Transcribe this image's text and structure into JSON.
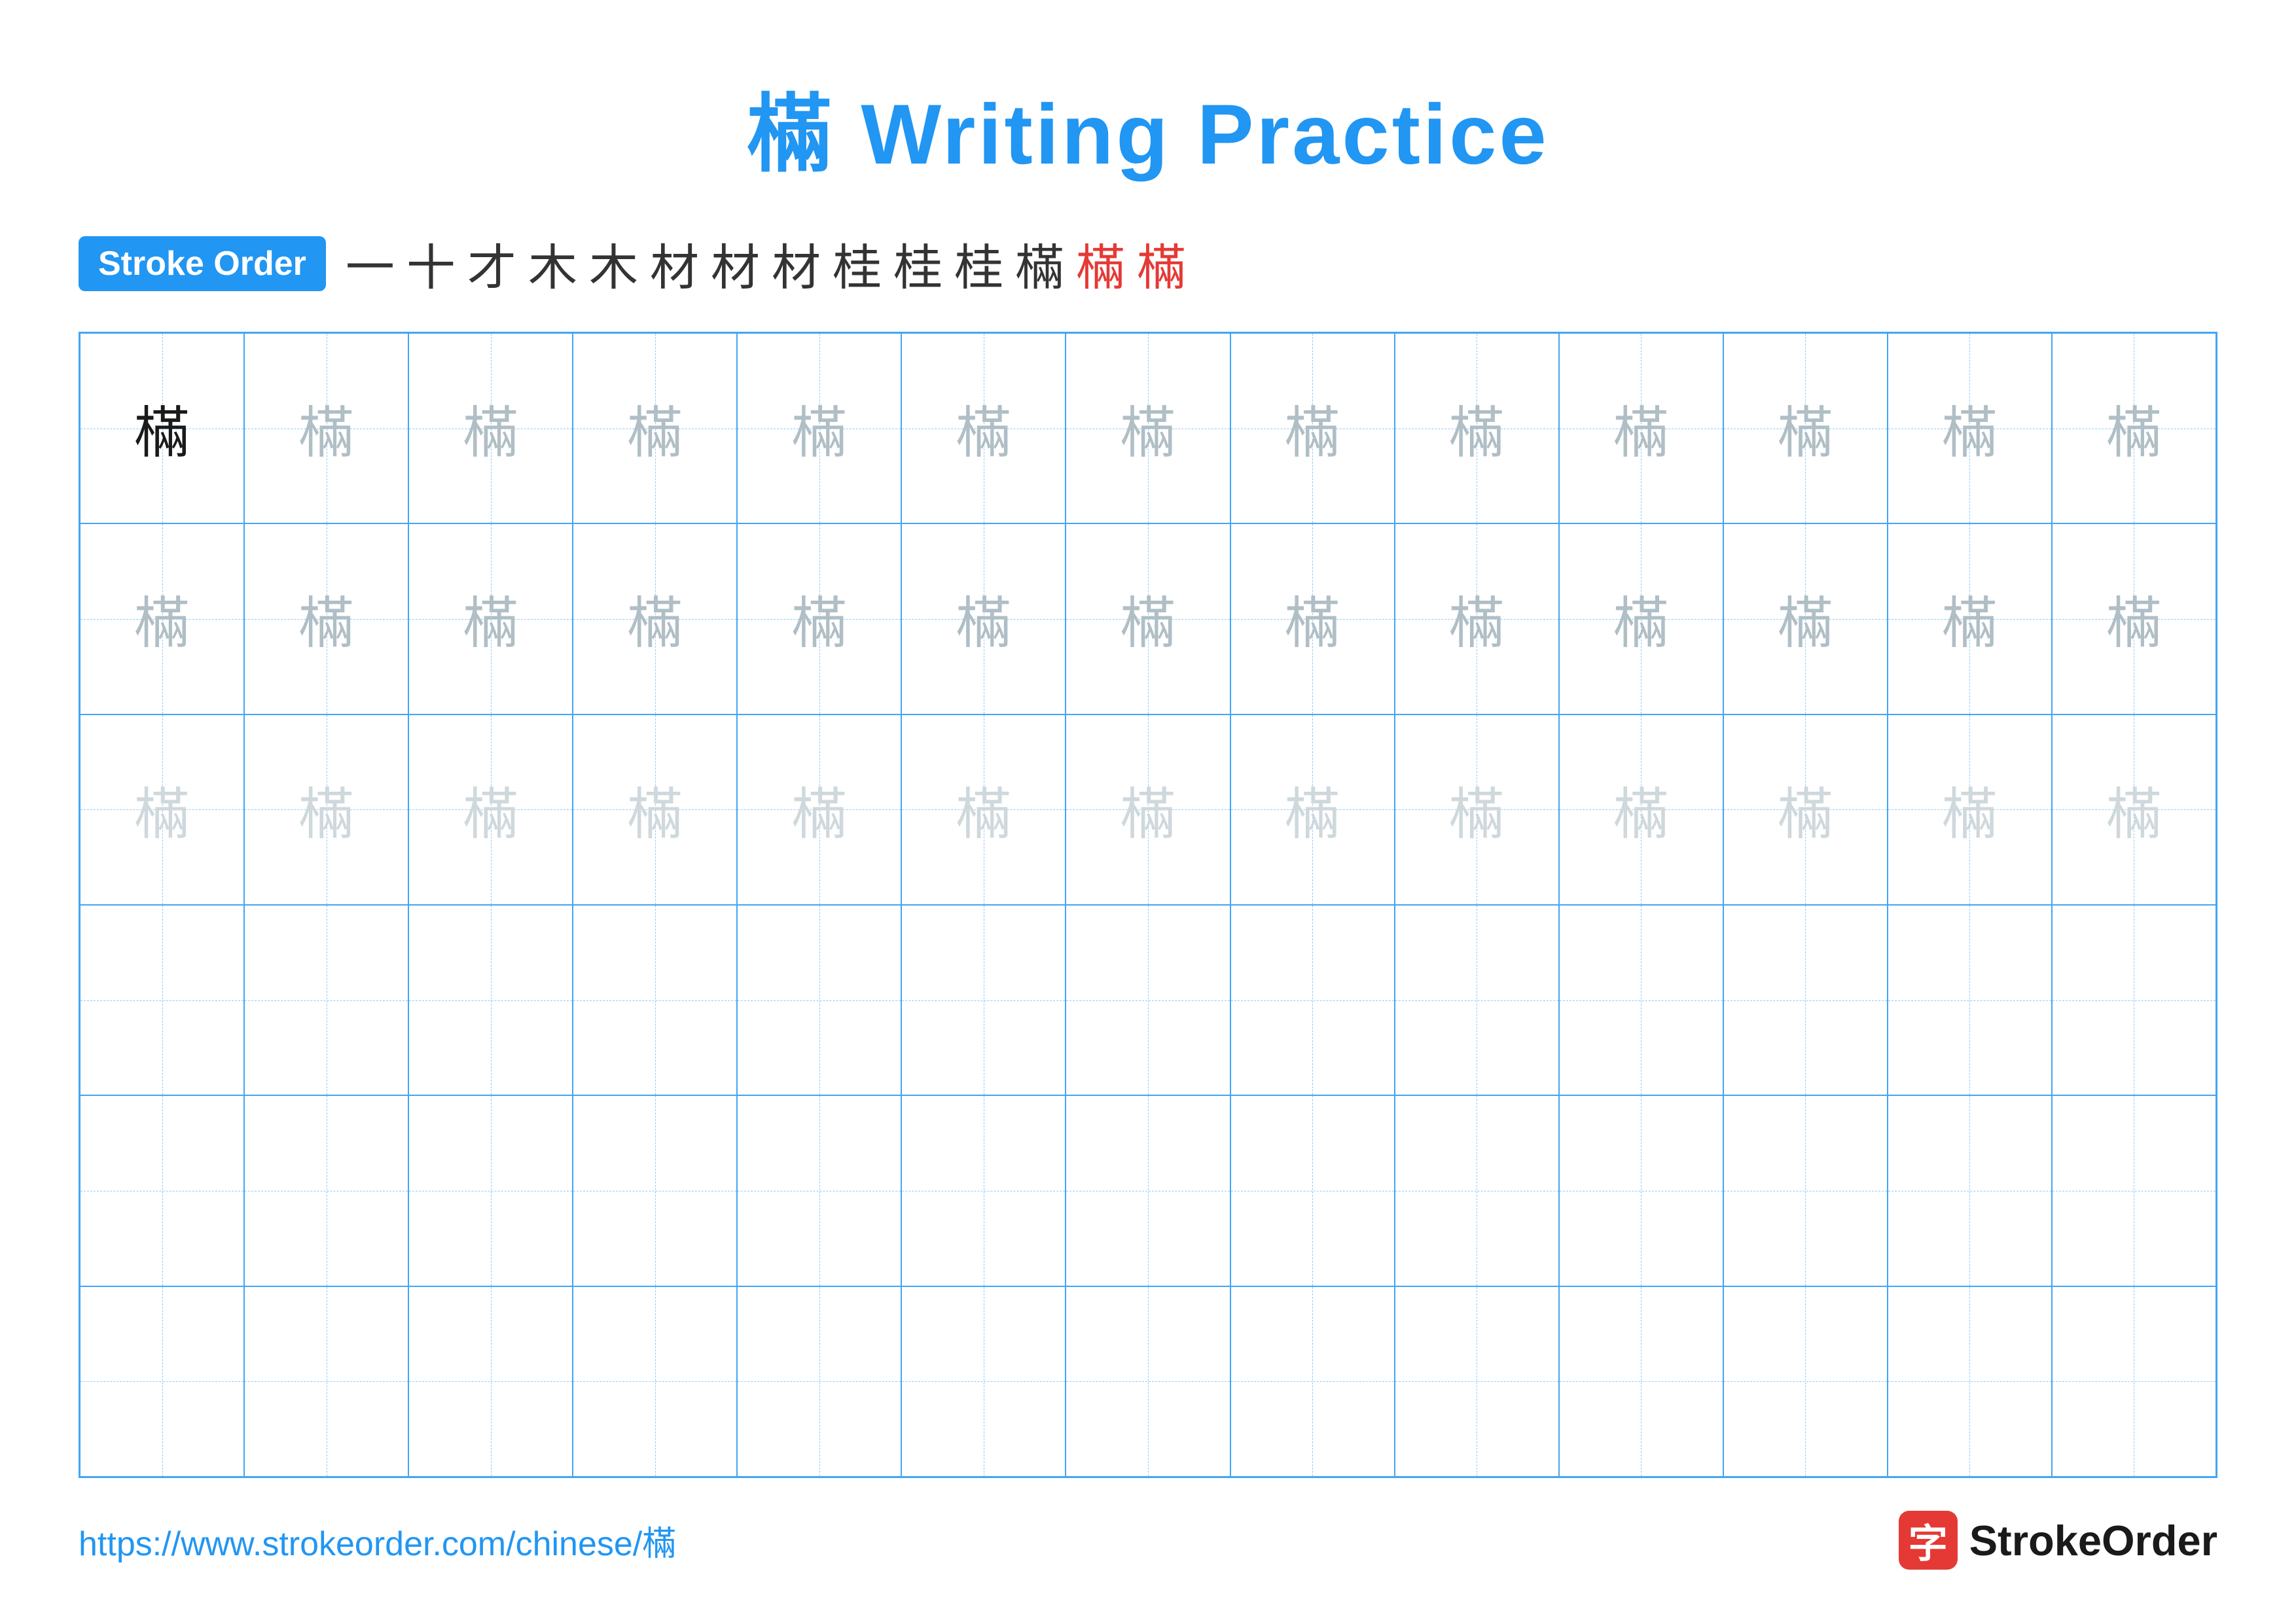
{
  "title": {
    "char": "樠",
    "text": " Writing Practice"
  },
  "stroke_order": {
    "badge_label": "Stroke Order",
    "steps": [
      "一",
      "十",
      "才",
      "木",
      "木",
      "材",
      "材",
      "材",
      "桂",
      "桂",
      "桂",
      "樠",
      "樠",
      "樠"
    ]
  },
  "grid": {
    "char": "樠",
    "rows": [
      {
        "type": "dark_then_medium",
        "cells": 13
      },
      {
        "type": "medium",
        "cells": 13
      },
      {
        "type": "light",
        "cells": 13
      },
      {
        "type": "empty",
        "cells": 13
      },
      {
        "type": "empty",
        "cells": 13
      },
      {
        "type": "empty",
        "cells": 13
      }
    ]
  },
  "footer": {
    "url": "https://www.strokeorder.com/chinese/樠",
    "logo_char": "字",
    "logo_text": "StrokeOrder"
  }
}
